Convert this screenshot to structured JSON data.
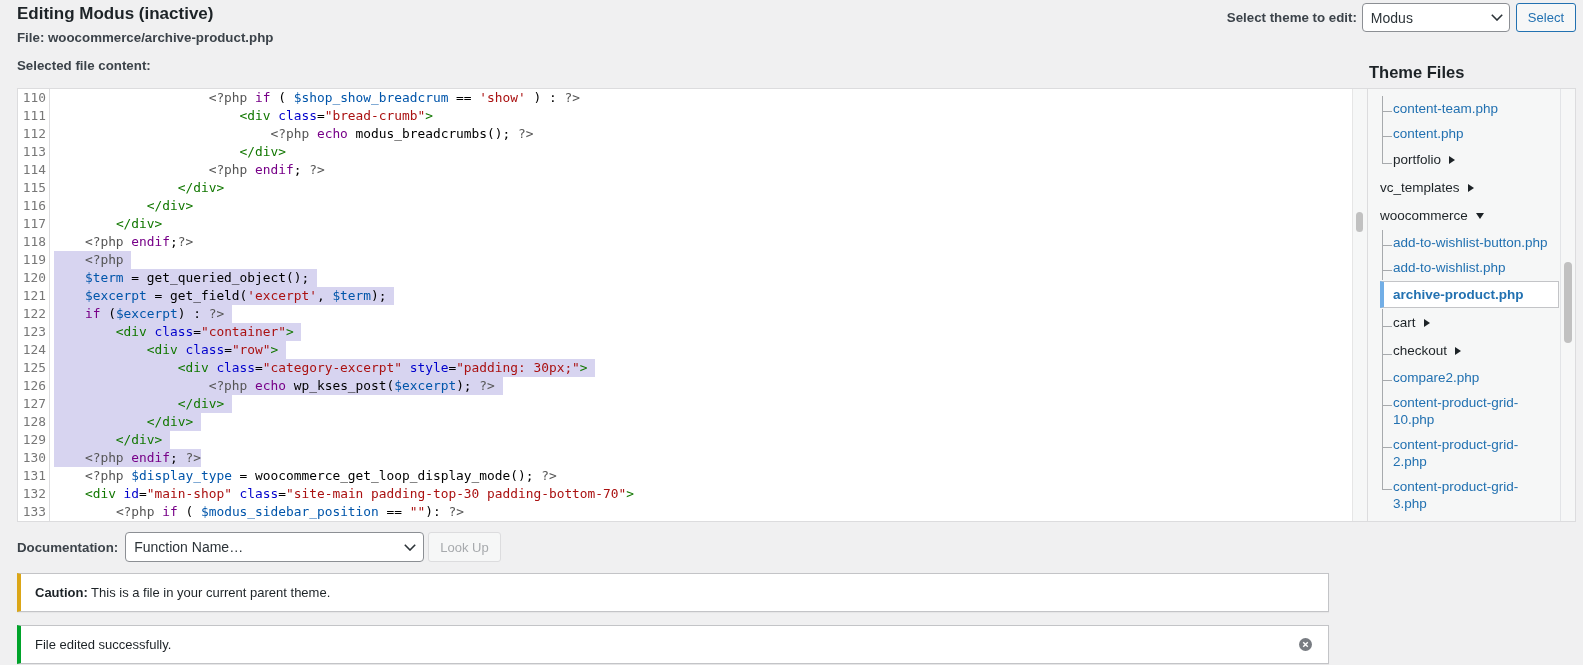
{
  "page": {
    "title": "Editing Modus (inactive)",
    "file_label": "File: woocommerce/archive-product.php"
  },
  "theme_selector": {
    "label": "Select theme to edit:",
    "value": "Modus",
    "button": "Select"
  },
  "editor": {
    "label": "Selected file content:",
    "lines": [
      {
        "number": "110",
        "selected": false,
        "tokens": [
          {
            "kind": "meta",
            "text": "                    <?php "
          },
          {
            "kind": "keyword",
            "text": "if"
          },
          {
            "kind": "plain",
            "text": " ( "
          },
          {
            "kind": "variable",
            "text": "$shop_show_breadcrum"
          },
          {
            "kind": "plain",
            "text": " == "
          },
          {
            "kind": "string",
            "text": "'show'"
          },
          {
            "kind": "plain",
            "text": " ) : "
          },
          {
            "kind": "meta",
            "text": "?>"
          }
        ]
      },
      {
        "number": "111",
        "selected": false,
        "tokens": [
          {
            "kind": "tag",
            "text": "                        <div "
          },
          {
            "kind": "attribute",
            "text": "class"
          },
          {
            "kind": "plain",
            "text": "="
          },
          {
            "kind": "string",
            "text": "\"bread-crumb\""
          },
          {
            "kind": "tag",
            "text": ">"
          }
        ]
      },
      {
        "number": "112",
        "selected": false,
        "tokens": [
          {
            "kind": "meta",
            "text": "                            <?php "
          },
          {
            "kind": "keyword",
            "text": "echo"
          },
          {
            "kind": "plain",
            "text": " modus_breadcrumbs(); "
          },
          {
            "kind": "meta",
            "text": "?>"
          }
        ]
      },
      {
        "number": "113",
        "selected": false,
        "tokens": [
          {
            "kind": "tag",
            "text": "                        </div>"
          }
        ]
      },
      {
        "number": "114",
        "selected": false,
        "tokens": [
          {
            "kind": "meta",
            "text": "                    <?php "
          },
          {
            "kind": "keyword",
            "text": "endif"
          },
          {
            "kind": "plain",
            "text": "; "
          },
          {
            "kind": "meta",
            "text": "?>"
          }
        ]
      },
      {
        "number": "115",
        "selected": false,
        "tokens": [
          {
            "kind": "tag",
            "text": "                </div>"
          }
        ]
      },
      {
        "number": "116",
        "selected": false,
        "tokens": [
          {
            "kind": "tag",
            "text": "            </div>"
          }
        ]
      },
      {
        "number": "117",
        "selected": false,
        "tokens": [
          {
            "kind": "tag",
            "text": "        </div>"
          }
        ]
      },
      {
        "number": "118",
        "selected": false,
        "tokens": [
          {
            "kind": "meta",
            "text": "    <?php "
          },
          {
            "kind": "keyword",
            "text": "endif"
          },
          {
            "kind": "plain",
            "text": ";"
          },
          {
            "kind": "meta",
            "text": "?>"
          }
        ]
      },
      {
        "number": "119",
        "selected": true,
        "tokens": [
          {
            "kind": "meta",
            "text": "    <?php"
          }
        ]
      },
      {
        "number": "120",
        "selected": true,
        "tokens": [
          {
            "kind": "variable",
            "text": "    $term"
          },
          {
            "kind": "plain",
            "text": " = get_queried_object();"
          }
        ]
      },
      {
        "number": "121",
        "selected": true,
        "tokens": [
          {
            "kind": "variable",
            "text": "    $excerpt"
          },
          {
            "kind": "plain",
            "text": " = get_field("
          },
          {
            "kind": "string",
            "text": "'excerpt'"
          },
          {
            "kind": "plain",
            "text": ", "
          },
          {
            "kind": "variable",
            "text": "$term"
          },
          {
            "kind": "plain",
            "text": ");"
          }
        ]
      },
      {
        "number": "122",
        "selected": true,
        "tokens": [
          {
            "kind": "keyword",
            "text": "    if"
          },
          {
            "kind": "plain",
            "text": " ("
          },
          {
            "kind": "variable",
            "text": "$excerpt"
          },
          {
            "kind": "plain",
            "text": ") : "
          },
          {
            "kind": "meta",
            "text": "?>"
          }
        ]
      },
      {
        "number": "123",
        "selected": true,
        "tokens": [
          {
            "kind": "tag",
            "text": "        <div "
          },
          {
            "kind": "attribute",
            "text": "class"
          },
          {
            "kind": "plain",
            "text": "="
          },
          {
            "kind": "string",
            "text": "\"container\""
          },
          {
            "kind": "tag",
            "text": ">"
          }
        ]
      },
      {
        "number": "124",
        "selected": true,
        "tokens": [
          {
            "kind": "tag",
            "text": "            <div "
          },
          {
            "kind": "attribute",
            "text": "class"
          },
          {
            "kind": "plain",
            "text": "="
          },
          {
            "kind": "string",
            "text": "\"row\""
          },
          {
            "kind": "tag",
            "text": ">"
          }
        ]
      },
      {
        "number": "125",
        "selected": true,
        "tokens": [
          {
            "kind": "tag",
            "text": "                <div "
          },
          {
            "kind": "attribute",
            "text": "class"
          },
          {
            "kind": "plain",
            "text": "="
          },
          {
            "kind": "string",
            "text": "\"category-excerpt\""
          },
          {
            "kind": "attribute",
            "text": " style"
          },
          {
            "kind": "plain",
            "text": "="
          },
          {
            "kind": "string",
            "text": "\"padding: 30px;\""
          },
          {
            "kind": "tag",
            "text": ">"
          }
        ]
      },
      {
        "number": "126",
        "selected": true,
        "tokens": [
          {
            "kind": "meta",
            "text": "                    <?php "
          },
          {
            "kind": "keyword",
            "text": "echo"
          },
          {
            "kind": "plain",
            "text": " wp_kses_post("
          },
          {
            "kind": "variable",
            "text": "$excerpt"
          },
          {
            "kind": "plain",
            "text": "); "
          },
          {
            "kind": "meta",
            "text": "?>"
          }
        ]
      },
      {
        "number": "127",
        "selected": true,
        "tokens": [
          {
            "kind": "tag",
            "text": "                </div>"
          }
        ]
      },
      {
        "number": "128",
        "selected": true,
        "tokens": [
          {
            "kind": "tag",
            "text": "            </div>"
          }
        ]
      },
      {
        "number": "129",
        "selected": true,
        "tokens": [
          {
            "kind": "tag",
            "text": "        </div>"
          }
        ]
      },
      {
        "number": "130",
        "selected": true,
        "tokens": [
          {
            "kind": "meta",
            "text": "    <?php "
          },
          {
            "kind": "keyword",
            "text": "endif"
          },
          {
            "kind": "plain",
            "text": "; "
          },
          {
            "kind": "meta",
            "text": "?>"
          }
        ]
      },
      {
        "number": "131",
        "selected": false,
        "tokens": [
          {
            "kind": "meta",
            "text": "    <?php "
          },
          {
            "kind": "variable",
            "text": "$display_type"
          },
          {
            "kind": "plain",
            "text": " = woocommerce_get_loop_display_mode(); "
          },
          {
            "kind": "meta",
            "text": "?>"
          }
        ]
      },
      {
        "number": "132",
        "selected": false,
        "tokens": [
          {
            "kind": "tag",
            "text": "    <div "
          },
          {
            "kind": "attribute",
            "text": "id"
          },
          {
            "kind": "plain",
            "text": "="
          },
          {
            "kind": "string",
            "text": "\"main-shop\""
          },
          {
            "kind": "attribute",
            "text": " class"
          },
          {
            "kind": "plain",
            "text": "="
          },
          {
            "kind": "string",
            "text": "\"site-main padding-top-30 padding-bottom-70\""
          },
          {
            "kind": "tag",
            "text": ">"
          }
        ]
      },
      {
        "number": "133",
        "selected": false,
        "tokens": [
          {
            "kind": "meta",
            "text": "        <?php "
          },
          {
            "kind": "keyword",
            "text": "if"
          },
          {
            "kind": "plain",
            "text": " ( "
          },
          {
            "kind": "variable",
            "text": "$modus_sidebar_position"
          },
          {
            "kind": "plain",
            "text": " == "
          },
          {
            "kind": "string",
            "text": "\"\""
          },
          {
            "kind": "plain",
            "text": "): "
          },
          {
            "kind": "meta",
            "text": "?>"
          }
        ]
      }
    ]
  },
  "theme_files": {
    "heading": "Theme Files",
    "tree": [
      {
        "kind": "continued",
        "children": [
          {
            "kind": "file",
            "name": "content-team.php",
            "selected": false
          },
          {
            "kind": "file",
            "name": "content.php",
            "selected": false
          },
          {
            "kind": "folder",
            "name": "portfolio",
            "expanded": false
          }
        ]
      },
      {
        "kind": "folder",
        "name": "vc_templates",
        "expanded": false
      },
      {
        "kind": "folder",
        "name": "woocommerce",
        "expanded": true,
        "children": [
          {
            "kind": "file",
            "name": "add-to-wishlist-button.php",
            "selected": false
          },
          {
            "kind": "file",
            "name": "add-to-wishlist.php",
            "selected": false
          },
          {
            "kind": "file",
            "name": "archive-product.php",
            "selected": true
          },
          {
            "kind": "folder",
            "name": "cart",
            "expanded": false
          },
          {
            "kind": "folder",
            "name": "checkout",
            "expanded": false
          },
          {
            "kind": "file",
            "name": "compare2.php",
            "selected": false
          },
          {
            "kind": "file",
            "name": "content-product-grid-10.php",
            "selected": false
          },
          {
            "kind": "file",
            "name": "content-product-grid-2.php",
            "selected": false
          },
          {
            "kind": "file",
            "name": "content-product-grid-3.php",
            "selected": false
          }
        ]
      }
    ]
  },
  "documentation": {
    "label": "Documentation:",
    "value": "Function Name…",
    "button": {
      "label": "Look Up",
      "disabled": true
    }
  },
  "notices": [
    {
      "kind": "warning",
      "text": "**Caution:** This is a file in your current parent theme.",
      "dismissible": false
    },
    {
      "kind": "success",
      "text": "File edited successfully.",
      "dismissible": true
    }
  ]
}
